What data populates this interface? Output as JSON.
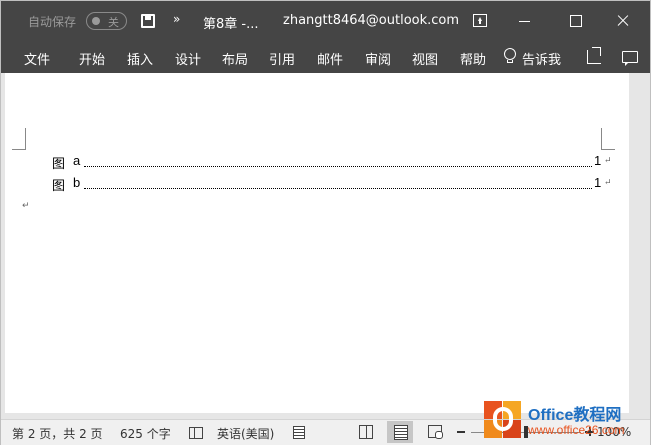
{
  "titlebar": {
    "autosave_label": "自动保存",
    "autosave_state": "关",
    "more_label": "»",
    "document_title": "第8章 -...",
    "account": "zhangtt8464@outlook.com"
  },
  "tabs": [
    {
      "label": "文件"
    },
    {
      "label": "开始"
    },
    {
      "label": "插入"
    },
    {
      "label": "设计"
    },
    {
      "label": "布局"
    },
    {
      "label": "引用"
    },
    {
      "label": "邮件"
    },
    {
      "label": "审阅"
    },
    {
      "label": "视图"
    },
    {
      "label": "帮助"
    }
  ],
  "tell_me": "告诉我",
  "document": {
    "toc": [
      {
        "label": "图",
        "name": "a",
        "page": "1",
        "mark": "↵"
      },
      {
        "label": "图",
        "name": "b",
        "page": "1",
        "mark": "↵"
      }
    ],
    "paragraph_mark": "↵"
  },
  "statusbar": {
    "page_info": "第 2 页，共 2 页",
    "word_count": "625 个字",
    "language": "英语(美国)",
    "zoom": "100%"
  },
  "watermark": {
    "title": "Office教程网",
    "url": "www.office26.com"
  },
  "colors": {
    "titlebar_bg": "#454545",
    "watermark_blue": "#1f6fc2",
    "watermark_orange": "#e8531f"
  }
}
